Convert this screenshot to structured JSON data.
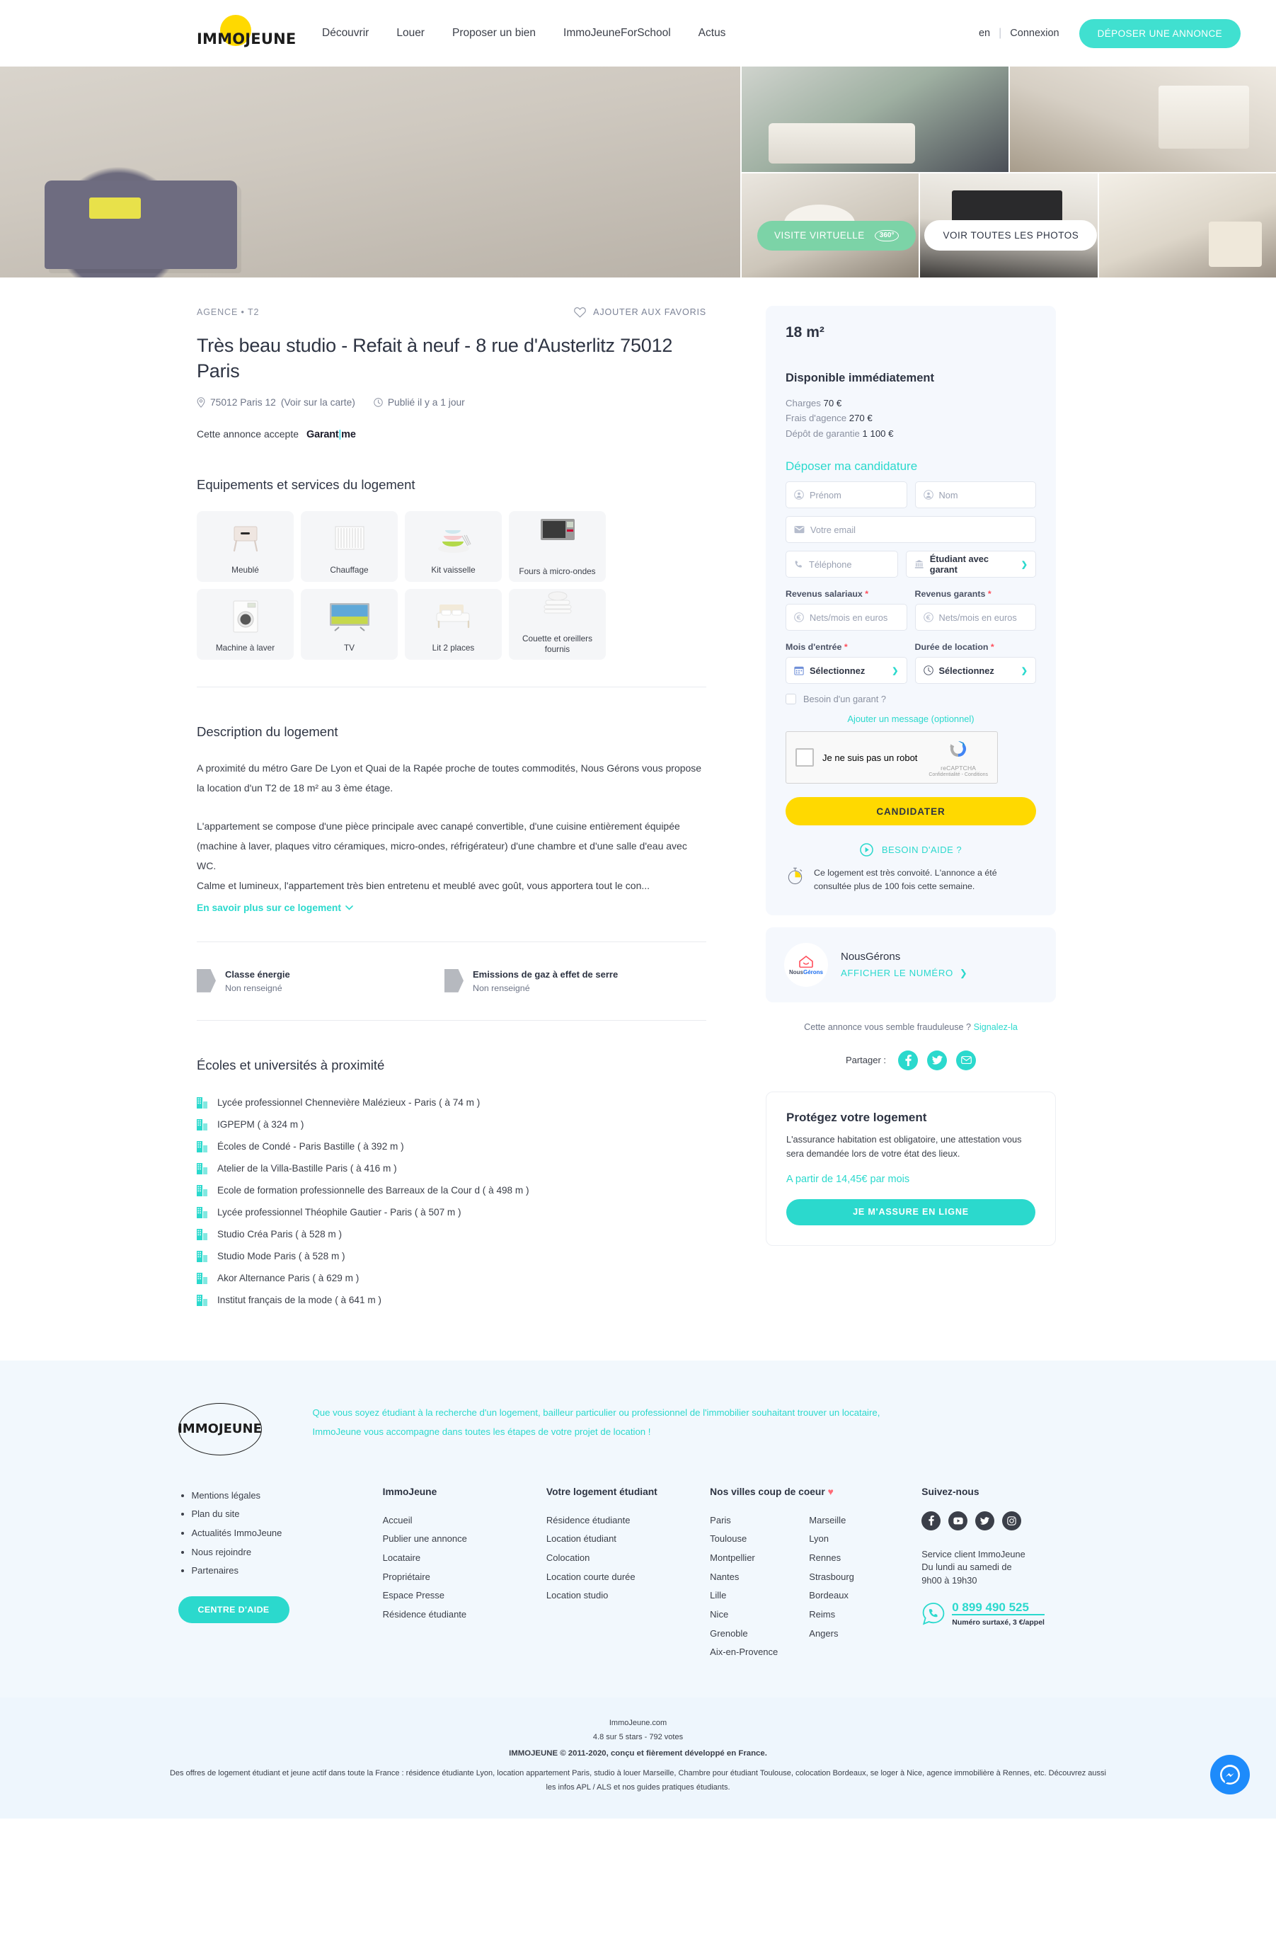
{
  "header": {
    "logo": "IMMOJEUNE",
    "nav": [
      "Découvrir",
      "Louer",
      "Proposer un bien",
      "ImmoJeuneForSchool",
      "Actus"
    ],
    "lang": "en",
    "separator": "|",
    "login": "Connexion",
    "cta": "DÉPOSER UNE ANNONCE"
  },
  "gallery": {
    "virtual_tour": "VISITE VIRTUELLE",
    "badge_360": "360°",
    "all_photos": "VOIR TOUTES LES PHOTOS"
  },
  "listing": {
    "breadcrumb": "AGENCE • T2",
    "favorite": "AJOUTER AUX FAVORIS",
    "title": "Très beau studio - Refait à neuf - 8 rue d'Austerlitz 75012 Paris",
    "location": "75012 Paris 12",
    "map_link": "(Voir sur la carte)",
    "published": "Publié il y a 1 jour",
    "accepts_label": "Cette annonce accepte",
    "accepts_brand_a": "Garant",
    "accepts_brand_b": "me"
  },
  "equipment": {
    "heading": "Equipements et services du logement",
    "items": [
      {
        "label": "Meublé",
        "icon": "nightstand-icon"
      },
      {
        "label": "Chauffage",
        "icon": "radiator-icon"
      },
      {
        "label": "Kit vaisselle",
        "icon": "dishes-icon"
      },
      {
        "label": "Fours à micro-ondes",
        "icon": "microwave-icon"
      },
      {
        "label": "Machine à laver",
        "icon": "washing-machine-icon"
      },
      {
        "label": "TV",
        "icon": "television-icon"
      },
      {
        "label": "Lit 2 places",
        "icon": "double-bed-icon"
      },
      {
        "label": "Couette et oreillers fournis",
        "icon": "bedding-icon"
      }
    ]
  },
  "description": {
    "heading": "Description du logement",
    "paragraph1": "A proximité du métro Gare De Lyon et Quai de la Rapée proche de toutes commodités, Nous Gérons vous propose la location d'un T2 de 18 m² au 3 ème étage.",
    "paragraph2": "L'appartement se compose d'une pièce principale avec canapé convertible, d'une cuisine entièrement équipée (machine à laver, plaques vitro céramiques, micro-ondes, réfrigérateur) d'une chambre et d'une salle d'eau avec WC.",
    "paragraph3": "Calme et lumineux, l'appartement très bien entretenu et meublé avec goût, vous apportera tout le con...",
    "more_link": "En savoir plus sur ce logement"
  },
  "dpe": [
    {
      "title": "Classe énergie",
      "value": "Non renseigné"
    },
    {
      "title": "Emissions de gaz à effet de serre",
      "value": "Non renseigné"
    }
  ],
  "schools": {
    "heading": "Écoles et universités à proximité",
    "items": [
      "Lycée professionnel Chennevière Malézieux - Paris ( à 74 m )",
      "IGPEPM ( à 324 m )",
      "Écoles de Condé - Paris Bastille ( à 392 m )",
      "Atelier de la Villa-Bastille Paris ( à 416 m )",
      "Ecole de formation professionnelle des Barreaux de la Cour d ( à 498 m )",
      "Lycée professionnel Théophile Gautier - Paris ( à 507 m )",
      "Studio Créa Paris ( à 528 m )",
      "Studio Mode Paris ( à 528 m )",
      "Akor Alternance Paris ( à 629 m )",
      "Institut français de la mode ( à 641 m )"
    ]
  },
  "sidebar": {
    "surface": "18 m²",
    "availability": "Disponible immédiatement",
    "fees": [
      {
        "label": "Charges",
        "value": "70 €"
      },
      {
        "label": "Frais d'agence",
        "value": "270 €"
      },
      {
        "label": "Dépôt de garantie",
        "value": "1 100 €"
      }
    ],
    "form_title": "Déposer ma candidature",
    "fields": {
      "firstname_placeholder": "Prénom",
      "lastname_placeholder": "Nom",
      "email_placeholder": "Votre email",
      "phone_placeholder": "Téléphone",
      "status_value": "Étudiant avec garant",
      "salary_label": "Revenus salariaux",
      "salary_placeholder": "Nets/mois en euros",
      "guarantor_income_label": "Revenus garants",
      "guarantor_income_placeholder": "Nets/mois en euros",
      "entry_month_label": "Mois d'entrée",
      "entry_month_value": "Sélectionnez",
      "duration_label": "Durée de location",
      "duration_value": "Sélectionnez",
      "required_mark": "*",
      "guarantor_checkbox": "Besoin d'un garant ?",
      "add_message": "Ajouter un message (optionnel)"
    },
    "captcha": {
      "text": "Je ne suis pas un robot",
      "brand": "reCAPTCHA",
      "links": "Confidentialité - Conditions"
    },
    "submit": "CANDIDATER",
    "help": "BESOIN D'AIDE ?",
    "hot_notice": "Ce logement est très convoité. L'annonce a été consultée plus de 100 fois cette semaine.",
    "agency": {
      "logo_a": "Nous",
      "logo_b": "Gérons",
      "name": "NousGérons",
      "show_number": "AFFICHER LE NUMÉRO",
      "chevron": "❯"
    },
    "fraud_text": "Cette annonce vous semble frauduleuse ?",
    "fraud_link": "Signalez-la",
    "share_label": "Partager :",
    "share_icons": [
      "facebook-icon",
      "twitter-icon",
      "email-icon"
    ],
    "insurance": {
      "heading": "Protégez votre logement",
      "text": "L'assurance habitation est obligatoire, une attestation vous sera demandée lors de votre état des lieux.",
      "price": "A partir de 14,45€ par mois",
      "cta": "JE M'ASSURE EN LIGNE"
    }
  },
  "footer": {
    "logo": "IMMOJEUNE",
    "intro_line1": "Que vous soyez étudiant à la recherche d'un logement, bailleur particulier ou professionnel de l'immobilier souhaitant trouver un locataire,",
    "intro_line2": "ImmoJeune vous accompagne dans toutes les étapes de votre projet de location !",
    "legal_links": [
      "Mentions légales",
      "Plan du site",
      "Actualités ImmoJeune",
      "Nous rejoindre",
      "Partenaires"
    ],
    "help_button": "CENTRE D'AIDE",
    "columns": [
      {
        "heading": "ImmoJeune",
        "links": [
          "Accueil",
          "Publier une annonce",
          "Locataire",
          "Propriétaire",
          "Espace Presse",
          "Résidence étudiante"
        ]
      },
      {
        "heading": "Votre logement étudiant",
        "links": [
          "Résidence étudiante",
          "Location étudiant",
          "Colocation",
          "Location courte durée",
          "Location studio"
        ]
      }
    ],
    "cities": {
      "heading": "Nos villes coup de coeur",
      "heart": "♥",
      "col1": [
        "Paris",
        "Toulouse",
        "Montpellier",
        "Nantes",
        "Lille",
        "Nice",
        "Grenoble",
        "Aix-en-Provence"
      ],
      "col2": [
        "Marseille",
        "Lyon",
        "Rennes",
        "Strasbourg",
        "Bordeaux",
        "Reims",
        "Angers"
      ]
    },
    "social": {
      "heading": "Suivez-nous",
      "icons": [
        "facebook-icon",
        "youtube-icon",
        "twitter-icon",
        "instagram-icon"
      ],
      "service_line1": "Service client ImmoJeune",
      "service_line2": "Du lundi au samedi de",
      "service_line3": "9h00 à 19h30",
      "phone": "0 899 490 525",
      "phone_note": "Numéro surtaxé, 3 €/appel"
    },
    "legal": {
      "site": "ImmoJeune.com",
      "rating": "4.8 sur 5 stars - 792 votes",
      "copyright": "IMMOJEUNE © 2011-2020, conçu et fièrement développé en France.",
      "seo": "Des offres de logement étudiant et jeune actif dans toute la France : résidence étudiante Lyon, location appartement Paris, studio à louer Marseille, Chambre pour étudiant Toulouse, colocation Bordeaux, se loger à Nice, agence immobilière à Rennes, etc. Découvrez aussi les infos APL / ALS et nos guides pratiques étudiants."
    }
  },
  "messenger": {
    "icon": "messenger-icon"
  },
  "colors": {
    "accent": "#2bd9cd",
    "yellow": "#FFD900",
    "green": "#7cd3a7",
    "required": "#ff4d5a",
    "messenger_blue": "#1d8bfb"
  }
}
